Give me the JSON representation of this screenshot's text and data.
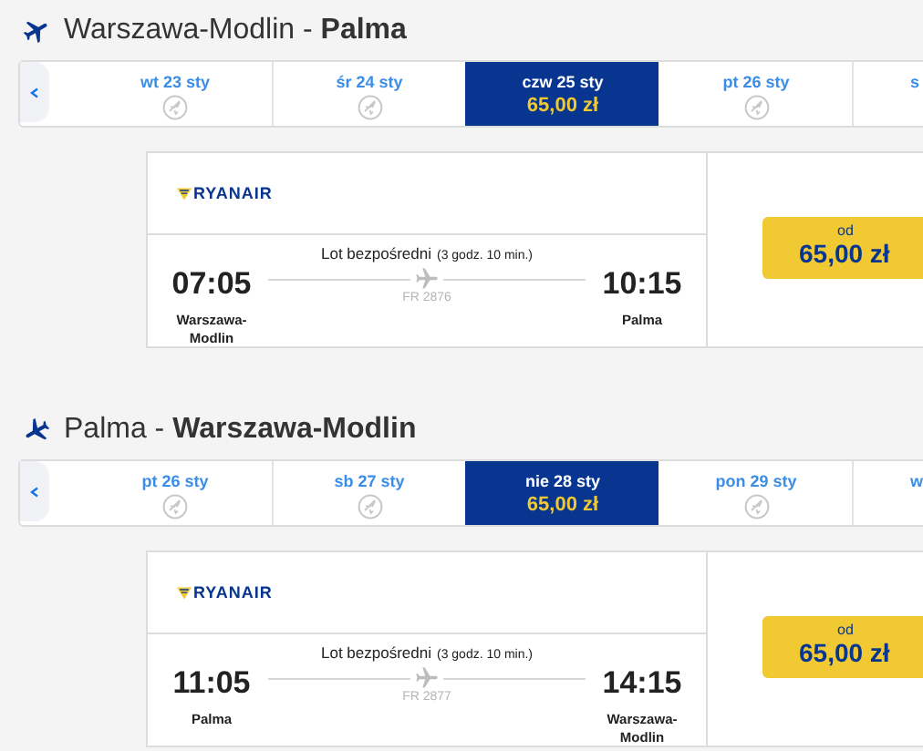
{
  "sections": [
    {
      "heading": "Warszawa-Modlin - **Palma**",
      "kind": "outbound",
      "dates": [
        {
          "label": "wt 23 sty",
          "selected": false
        },
        {
          "label": "śr 24 sty",
          "selected": false
        },
        {
          "label": "czw 25 sty",
          "selected": true,
          "price": "65,00 zł"
        },
        {
          "label": "pt 26 sty",
          "selected": false
        },
        {
          "label": "s",
          "selected": false
        }
      ],
      "flight": {
        "airline": "RYANAIR",
        "type": "Lot bezpośredni",
        "duration": "(3 godz. 10 min.)",
        "dep_time": "07:05",
        "arr_time": "10:15",
        "number": "FR 2876",
        "dep_city": "Warszawa-Modlin",
        "arr_city": "Palma",
        "price_label": "od",
        "price": "65,00 zł"
      }
    },
    {
      "heading": "Palma - **Warszawa-Modlin**",
      "kind": "inbound",
      "dates": [
        {
          "label": "pt 26 sty",
          "selected": false
        },
        {
          "label": "sb 27 sty",
          "selected": false
        },
        {
          "label": "nie 28 sty",
          "selected": true,
          "price": "65,00 zł"
        },
        {
          "label": "pon 29 sty",
          "selected": false
        },
        {
          "label": "w",
          "selected": false
        }
      ],
      "flight": {
        "airline": "RYANAIR",
        "type": "Lot bezpośredni",
        "duration": "(3 godz. 10 min.)",
        "dep_time": "11:05",
        "arr_time": "14:15",
        "number": "FR 2877",
        "dep_city": "Palma",
        "arr_city": "Warszawa-Modlin",
        "price_label": "od",
        "price": "65,00 zł"
      }
    }
  ]
}
